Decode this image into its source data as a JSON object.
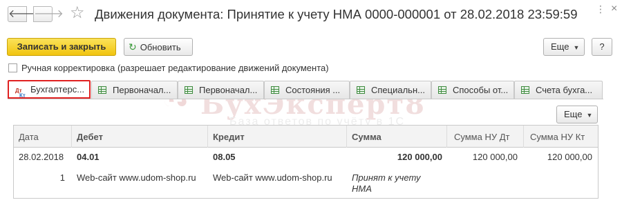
{
  "window": {
    "title": "Движения документа: Принятие к учету НМА 0000-000001 от 28.02.2018 23:59:59",
    "menu_icon": "⋮",
    "close_icon": "×"
  },
  "nav": {
    "back_icon": "arrow-left-icon",
    "forward_icon": "arrow-right-icon",
    "star_icon": "star-icon"
  },
  "toolbar": {
    "save_close_label": "Записать и закрыть",
    "refresh_label": "Обновить",
    "more_label": "Еще",
    "help_label": "?"
  },
  "manual_edit": {
    "label": "Ручная корректировка (разрешает редактирование движений документа)",
    "checked": false
  },
  "tabs": [
    {
      "label": "Бухгалтерс...",
      "active": true
    },
    {
      "label": "Первоначал..."
    },
    {
      "label": "Первоначал..."
    },
    {
      "label": "Состояния ..."
    },
    {
      "label": "Специальн..."
    },
    {
      "label": "Способы от..."
    },
    {
      "label": "Счета бухга..."
    }
  ],
  "panel": {
    "more_label": "Еще"
  },
  "watermark": {
    "title": "БухЭксперт8",
    "subtitle": "База ответов по учёту в 1С"
  },
  "table": {
    "columns": [
      "Дата",
      "Дебет",
      "Кредит",
      "Сумма",
      "Сумма НУ Дт",
      "Сумма НУ Кт"
    ],
    "row": {
      "date": "28.02.2018",
      "debit_account": "04.01",
      "credit_account": "08.05",
      "amount": "120 000,00",
      "amount_nu_dt": "120 000,00",
      "amount_nu_kt": "120 000,00",
      "line_number": "1",
      "debit_subconto": "Web-сайт www.udom-shop.ru",
      "credit_subconto": "Web-сайт www.udom-shop.ru",
      "content_line1": "Принят к учету",
      "content_line2": "НМА"
    }
  },
  "colors": {
    "primary_button": "#f1c40f",
    "active_tab_border": "#e02020",
    "table_header_bg": "#f3f3f3"
  }
}
